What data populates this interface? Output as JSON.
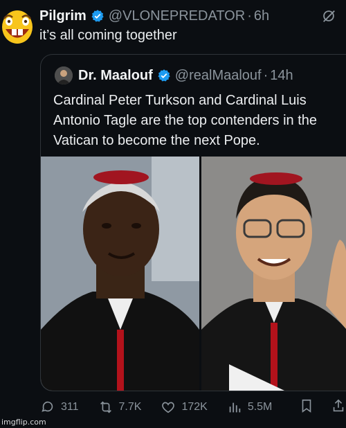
{
  "tweet": {
    "author_name": "Pilgrim",
    "handle": "@VLONEPREDATOR",
    "separator": "·",
    "time": "6h",
    "text": "it’s all coming together"
  },
  "quoted": {
    "author_name": "Dr. Maalouf",
    "handle": "@realMaalouf",
    "separator": "·",
    "time": "14h",
    "text": "Cardinal Peter Turkson and Cardinal Luis Antonio Tagle are the top contenders in the Vatican to become the next Pope."
  },
  "actions": {
    "replies": "311",
    "reposts": "7.7K",
    "likes": "172K",
    "views": "5.5M"
  },
  "icons": {
    "avatar": "laughing-emoji-icon",
    "verified": "verified-badge-icon",
    "grok": "grok-icon",
    "reply": "reply-icon",
    "repost": "repost-icon",
    "like": "heart-icon",
    "views": "views-icon",
    "bookmark": "bookmark-icon",
    "share": "share-icon"
  },
  "colors": {
    "background": "#0b0e12",
    "verified": "#1d9bf0",
    "muted": "#8b949c"
  },
  "watermark": "imgflip.com"
}
